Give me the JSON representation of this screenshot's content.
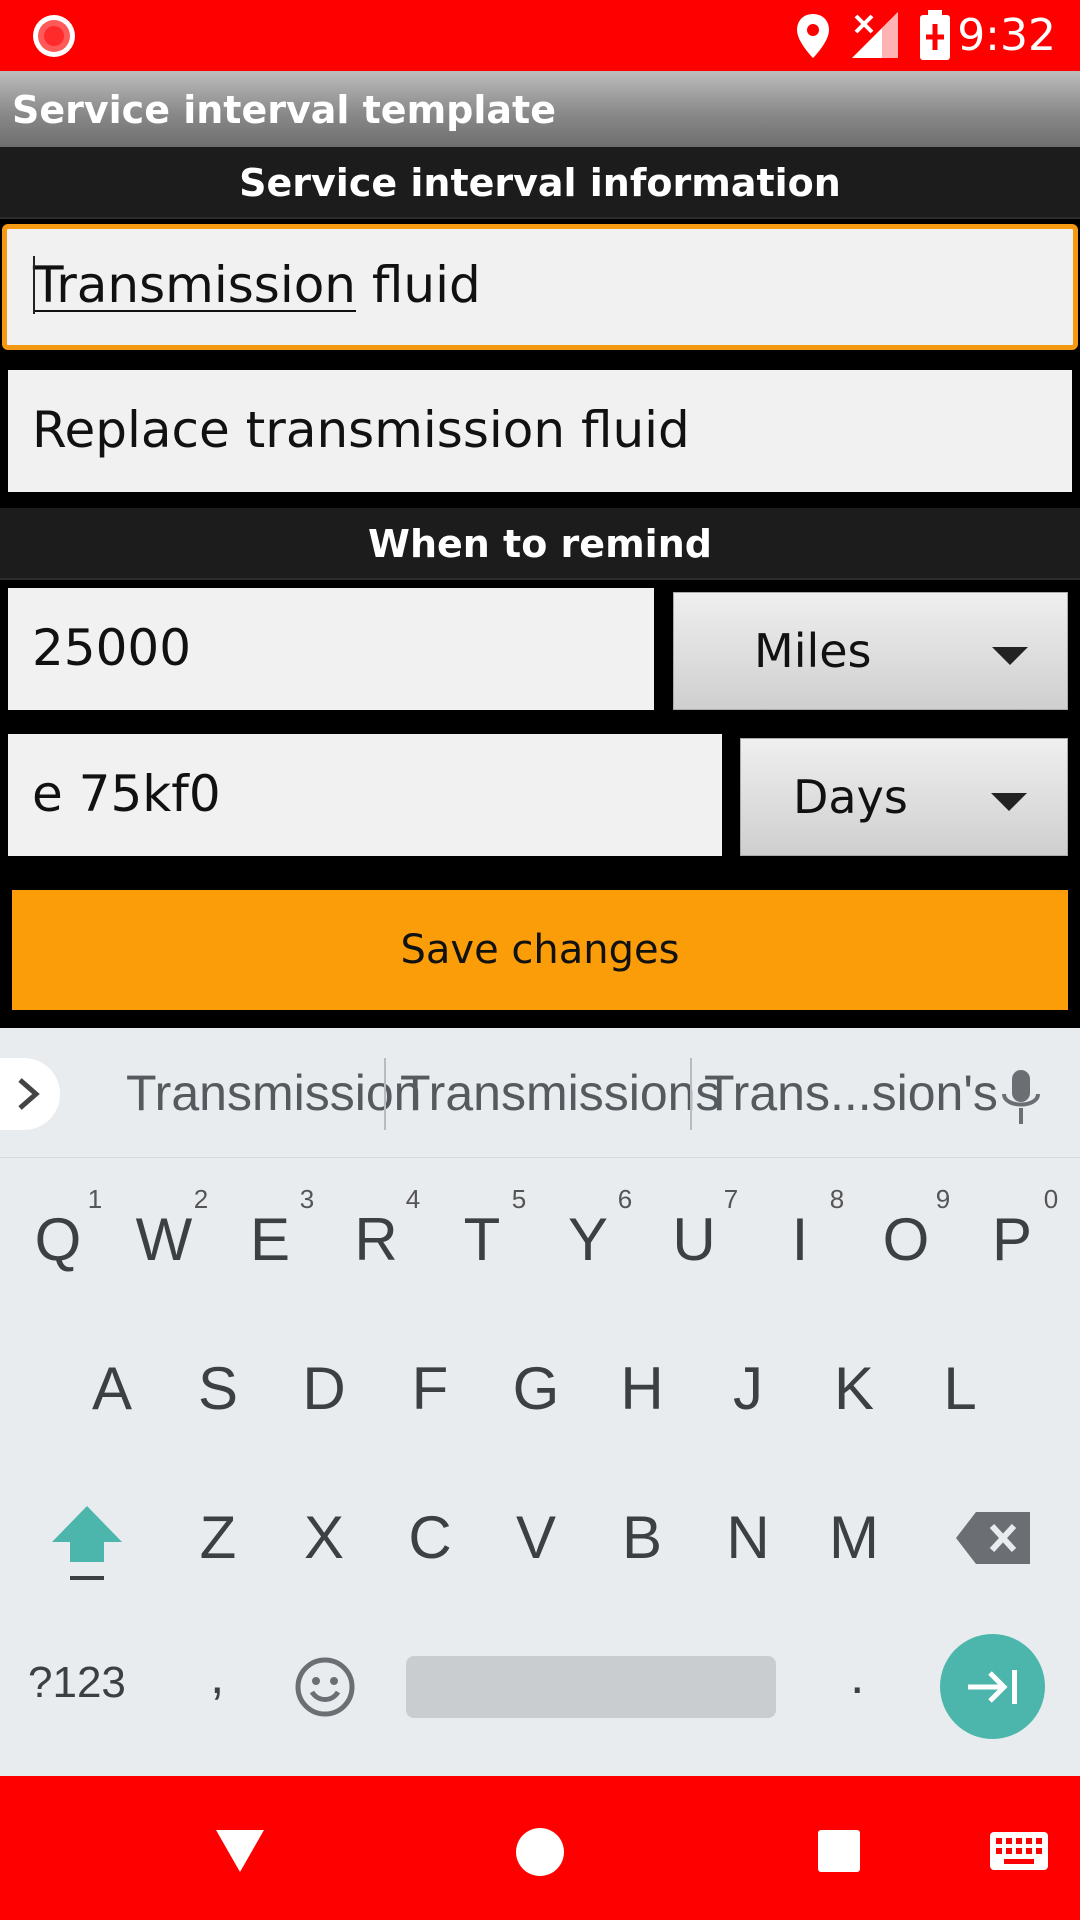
{
  "status_bar": {
    "time": "9:32"
  },
  "app": {
    "title": "Service interval template"
  },
  "sections": {
    "info_header": "Service interval information",
    "remind_header": "When to remind"
  },
  "fields": {
    "name_underlined": "Transmission",
    "name_rest": " fluid",
    "description": "Replace transmission fluid",
    "mileage_value": "25000",
    "days_value": "e 75kf0"
  },
  "spinners": {
    "distance_unit": "Miles",
    "time_unit": "Days"
  },
  "buttons": {
    "save": "Save changes"
  },
  "keyboard": {
    "suggestions": [
      "Transmission",
      "Transmissions",
      "Trans...sion's"
    ],
    "row1": [
      "Q",
      "W",
      "E",
      "R",
      "T",
      "Y",
      "U",
      "I",
      "O",
      "P"
    ],
    "row1_hints": [
      "1",
      "2",
      "3",
      "4",
      "5",
      "6",
      "7",
      "8",
      "9",
      "0"
    ],
    "row2": [
      "A",
      "S",
      "D",
      "F",
      "G",
      "H",
      "J",
      "K",
      "L"
    ],
    "row3": [
      "Z",
      "X",
      "C",
      "V",
      "B",
      "N",
      "M"
    ],
    "symbols_label": "?123",
    "comma": ",",
    "period": "."
  },
  "colors": {
    "status_bar": "#ff0000",
    "accent": "#fb9d08",
    "focus": "#f39a12",
    "enter_key": "#4db6ac"
  }
}
